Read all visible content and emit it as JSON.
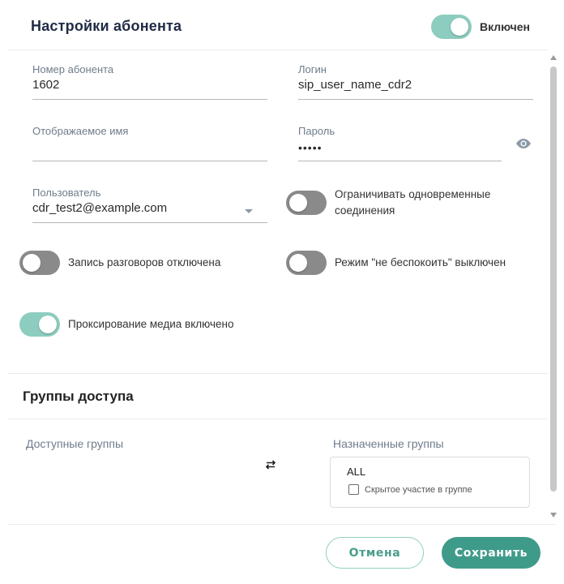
{
  "header": {
    "title": "Настройки абонента",
    "enabled_label": "Включен",
    "enabled": true
  },
  "fields": {
    "number": {
      "label": "Номер абонента",
      "value": "1602"
    },
    "login": {
      "label": "Логин",
      "value": "sip_user_name_cdr2"
    },
    "display_name": {
      "label": "Отображаемое имя",
      "value": ""
    },
    "password": {
      "label": "Пароль",
      "value": "•••••"
    },
    "user": {
      "label": "Пользователь",
      "value": "cdr_test2@example.com"
    }
  },
  "toggles": {
    "limit_connections": {
      "label_line1": "Ограничивать одновременные",
      "label_line2": "соединения",
      "on": false
    },
    "recording": {
      "label": "Запись разговоров отключена",
      "on": false
    },
    "dnd": {
      "label": "Режим \"не беспокоить\" выключен",
      "on": false
    },
    "media_proxy": {
      "label": "Проксирование медиа включено",
      "on": true
    }
  },
  "groups": {
    "title": "Группы доступа",
    "available_label": "Доступные группы",
    "assigned_label": "Назначенные группы",
    "assigned": [
      {
        "name": "ALL",
        "hidden_label": "Скрытое участие в группе",
        "hidden": false
      }
    ]
  },
  "footer": {
    "cancel_label": "Отмена",
    "save_label": "Сохранить"
  },
  "colors": {
    "accent": "#3f9b89",
    "toggle_on": "#8ccdbf",
    "toggle_off": "#8a8a8a",
    "title": "#1f2a44"
  },
  "icons": [
    "eye-icon",
    "swap-arrows-icon",
    "chevron-down-icon"
  ]
}
